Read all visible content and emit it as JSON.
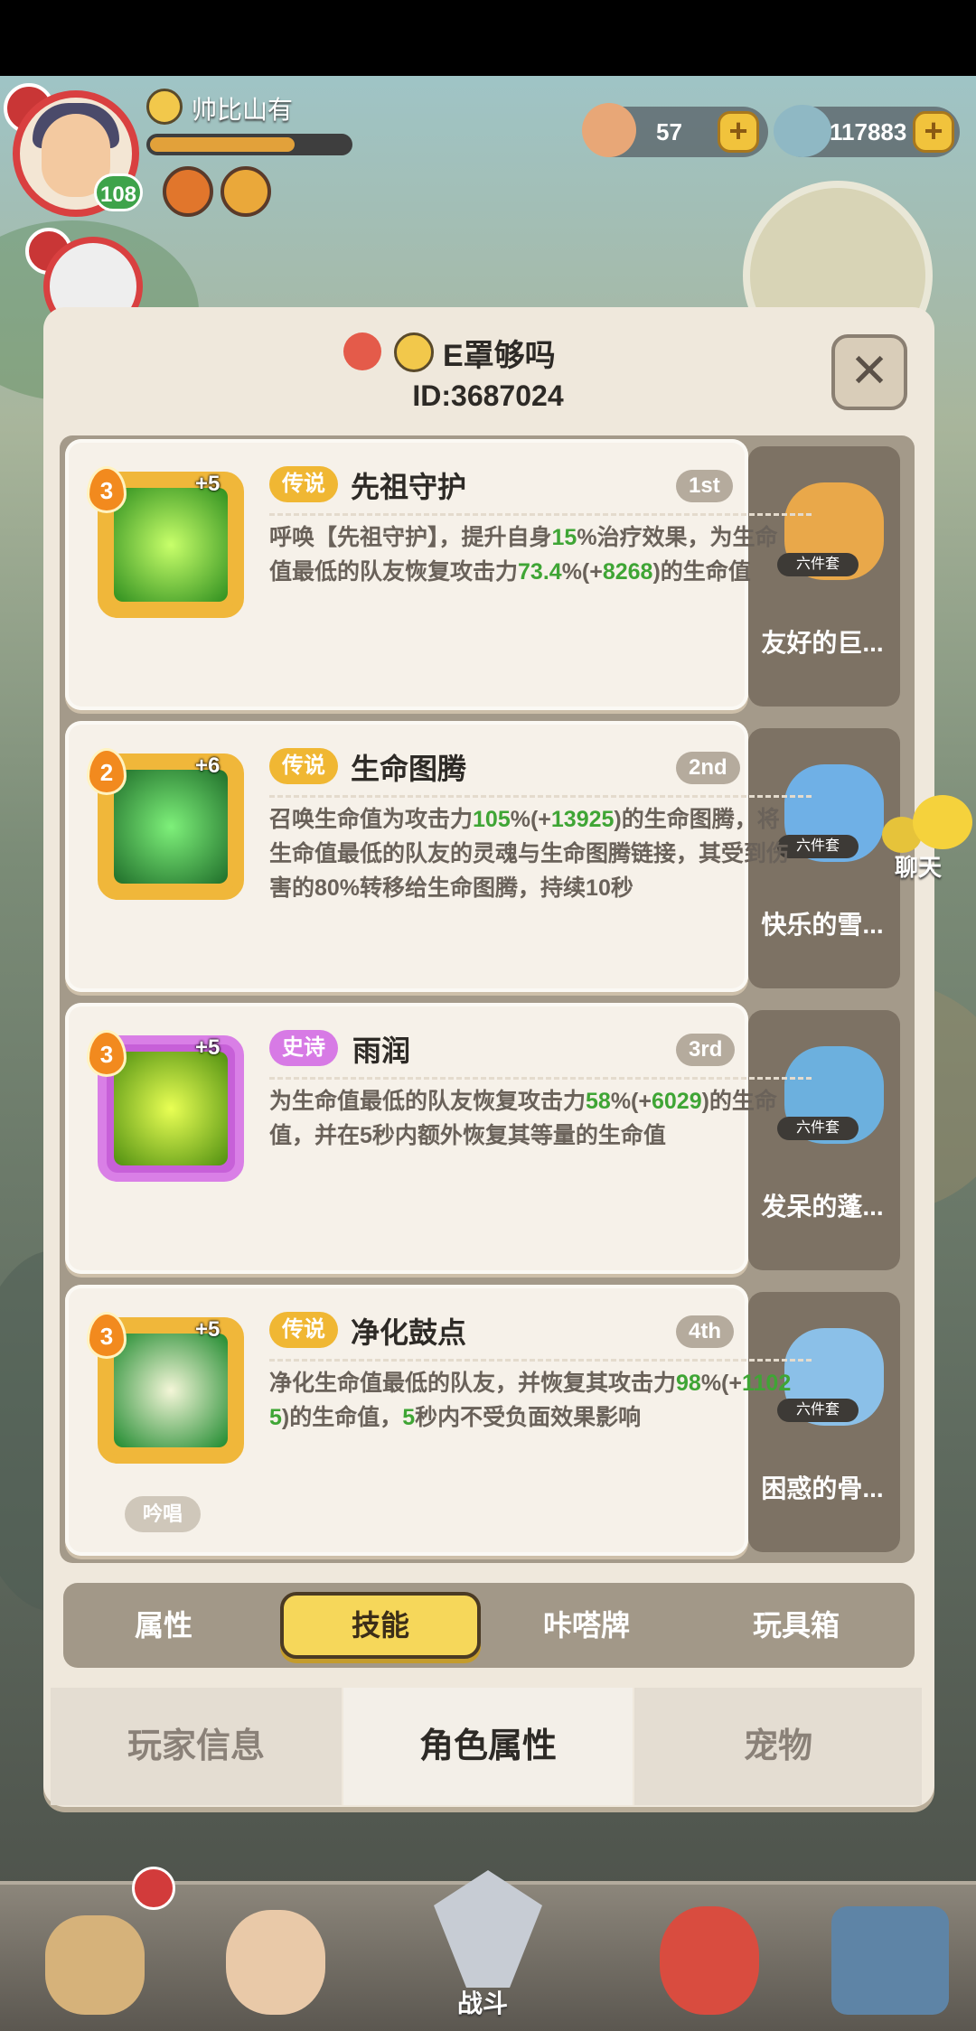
{
  "header": {
    "player_name": "帅比山有",
    "player_level": "108",
    "currency_shells": "57",
    "currency_pearls": "117883",
    "plus_label": "+"
  },
  "modal": {
    "title": "E罩够吗",
    "player_id": "ID:3687024",
    "close_label": "✕"
  },
  "skills": [
    {
      "level": "3",
      "plus": "+5",
      "rarity": "传说",
      "name": "先祖守护",
      "order": "1st",
      "desc_parts": [
        "呼唤【先祖守护】，提升自身",
        "15",
        "%治疗效果，为生命值最低的队友恢复攻击力",
        "73.4",
        "%(+",
        "8268",
        ")的生命值"
      ],
      "set_tag": "六件套",
      "set_name": "友好的巨..."
    },
    {
      "level": "2",
      "plus": "+6",
      "rarity": "传说",
      "name": "生命图腾",
      "order": "2nd",
      "desc_parts": [
        "召唤生命值为攻击力",
        "105",
        "%(+",
        "13925",
        ")的生命图腾，将生命值最低的队友的灵魂与生命图腾链接，其受到伤害的80%转移给生命图腾，持续10秒",
        "",
        "",
        ""
      ],
      "set_tag": "六件套",
      "set_name": "快乐的雪..."
    },
    {
      "level": "3",
      "plus": "+5",
      "rarity": "史诗",
      "name": "雨润",
      "order": "3rd",
      "desc_parts": [
        "为生命值最低的队友恢复攻击力",
        "58",
        "%(+",
        "6029",
        ")的生命值，并在5秒内额外恢复其等量的生命值",
        "",
        "",
        ""
      ],
      "set_tag": "六件套",
      "set_name": "发呆的蓬..."
    },
    {
      "level": "3",
      "plus": "+5",
      "rarity": "传说",
      "name": "净化鼓点",
      "order": "4th",
      "desc_parts": [
        "净化生命值最低的队友，并恢复其攻击力",
        "98",
        "%(+",
        "11025",
        ")的生命值，",
        "5",
        "秒内不受负面效果影响",
        ""
      ],
      "set_tag": "六件套",
      "set_name": "困惑的骨..."
    }
  ],
  "chant_label": "吟唱",
  "sub_tabs": [
    "属性",
    "技能",
    "咔嗒牌",
    "玩具箱"
  ],
  "main_tabs": [
    "玩家信息",
    "角色属性",
    "宠物"
  ],
  "chat_label": "聊天",
  "bottom_nav": {
    "center_label": "战斗"
  },
  "colors": {
    "legend": "#f0b733",
    "epic": "#d77ae5",
    "highlight_green": "#3fa535",
    "active_tab": "#f6d75a"
  }
}
